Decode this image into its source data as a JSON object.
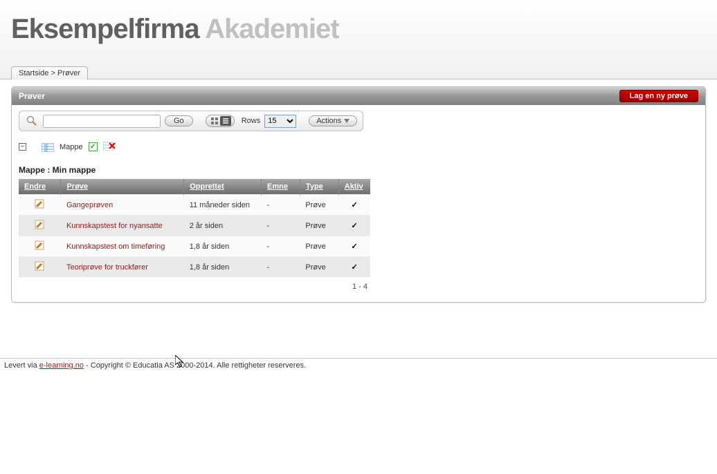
{
  "header": {
    "logo_main": "Eksempelfirma",
    "logo_sub": "Akademiet"
  },
  "breadcrumb": {
    "home": "Startside",
    "sep": ">",
    "current": "Prøver"
  },
  "panel": {
    "title": "Prøver",
    "new_button": "Lag en ny prøve"
  },
  "toolbar": {
    "go": "Go",
    "rows_label": "Rows",
    "rows_value": "15",
    "actions": "Actions"
  },
  "filter": {
    "column_label": "Mappe"
  },
  "group_label": "Mappe : Min mappe",
  "columns": {
    "c0": "Endre",
    "c1": "Prøve",
    "c2": "Opprettet",
    "c3": "Emne",
    "c4": "Type",
    "c5": "Aktiv"
  },
  "rows": [
    {
      "name": "Gangeprøven",
      "created": "11 måneder siden",
      "subject": "-",
      "type": "Prøve",
      "active": "✓"
    },
    {
      "name": "Kunnskapstest for nyansatte",
      "created": "2 år siden",
      "subject": "-",
      "type": "Prøve",
      "active": "✓"
    },
    {
      "name": "Kunnskapstest om timeføring",
      "created": "1,8 år siden",
      "subject": "-",
      "type": "Prøve",
      "active": "✓"
    },
    {
      "name": "Teoriprøve for truckfører",
      "created": "1,8 år siden",
      "subject": "-",
      "type": "Prøve",
      "active": "✓"
    }
  ],
  "pager": "1 - 4",
  "footer": {
    "prefix": "Levert via ",
    "link": "e-learning.no",
    "suffix": " - Copyright © Educatia AS 2000-2014. Alle rettigheter reserveres."
  }
}
